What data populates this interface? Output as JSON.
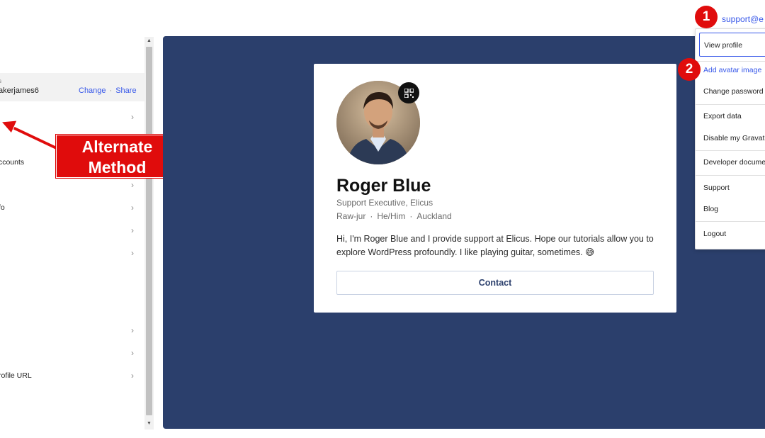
{
  "sidebar": {
    "account": {
      "label_fragment": "s",
      "username": "akerjames6",
      "change_label": "Change",
      "share_label": "Share",
      "separator": "·"
    },
    "items": [
      {
        "label": ""
      },
      {
        "label": "ccounts"
      },
      {
        "label": ""
      },
      {
        "label": "fo"
      },
      {
        "label": ""
      },
      {
        "label": ""
      },
      {
        "label": ""
      },
      {
        "label": ""
      },
      {
        "label": "rofile URL"
      }
    ]
  },
  "annotation": {
    "alternate_line1": "Alternate",
    "alternate_line2": "Method",
    "badge1": "1",
    "badge2": "2",
    "color": "#e00c0c"
  },
  "profile_card": {
    "name": "Roger Blue",
    "job_title": "Support Executive, Elicus",
    "meta": [
      "Raw-jur",
      "He/Him",
      "Auckland"
    ],
    "meta_separator": "·",
    "bio": "Hi, I'm Roger Blue and I provide support at Elicus. Hope our tutorials allow you to explore WordPress profoundly. I like playing guitar, sometimes. 😅",
    "contact_label": "Contact",
    "background_color": "#2b3f6c"
  },
  "user_menu": {
    "email": "support@e",
    "items": {
      "view_profile": "View profile",
      "add_avatar": "Add avatar image",
      "change_password": "Change password",
      "export_data": "Export data",
      "disable_gravatar": "Disable my Gravat",
      "developer_docs": "Developer docume",
      "support": "Support",
      "blog": "Blog",
      "logout": "Logout"
    }
  },
  "colors": {
    "link": "#3858e9",
    "preview_bg": "#2b3f6c"
  }
}
